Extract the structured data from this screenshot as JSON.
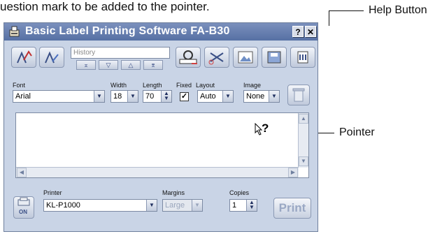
{
  "caption": "uestion mark to be added to the pointer.",
  "callouts": {
    "help_button": "Help Button",
    "pointer": "Pointer"
  },
  "window": {
    "title": "Basic Label Printing Software FA-B30",
    "help_glyph": "?",
    "close_glyph": "✕"
  },
  "toolbar": {
    "history_placeholder": "History",
    "nav": [
      "⌅",
      "▽",
      "△",
      "⌆"
    ]
  },
  "fields": {
    "font_label": "Font",
    "font_value": "Arial",
    "width_label": "Width",
    "width_value": "18",
    "length_label": "Length",
    "length_value": "70",
    "fixed_label": "Fixed",
    "layout_label": "Layout",
    "layout_value": "Auto",
    "image_label": "Image",
    "image_value": "None"
  },
  "pointer_glyph": "?",
  "bottom": {
    "printer_label": "Printer",
    "printer_value": "KL-P1000",
    "margins_label": "Margins",
    "margins_value": "Large",
    "copies_label": "Copies",
    "copies_value": "1",
    "print_label": "Print",
    "on_label": "ON"
  },
  "colors": {
    "titlebar": "#5c74a8",
    "window_bg": "#c9d4e6",
    "accent": "#3a4f86"
  }
}
